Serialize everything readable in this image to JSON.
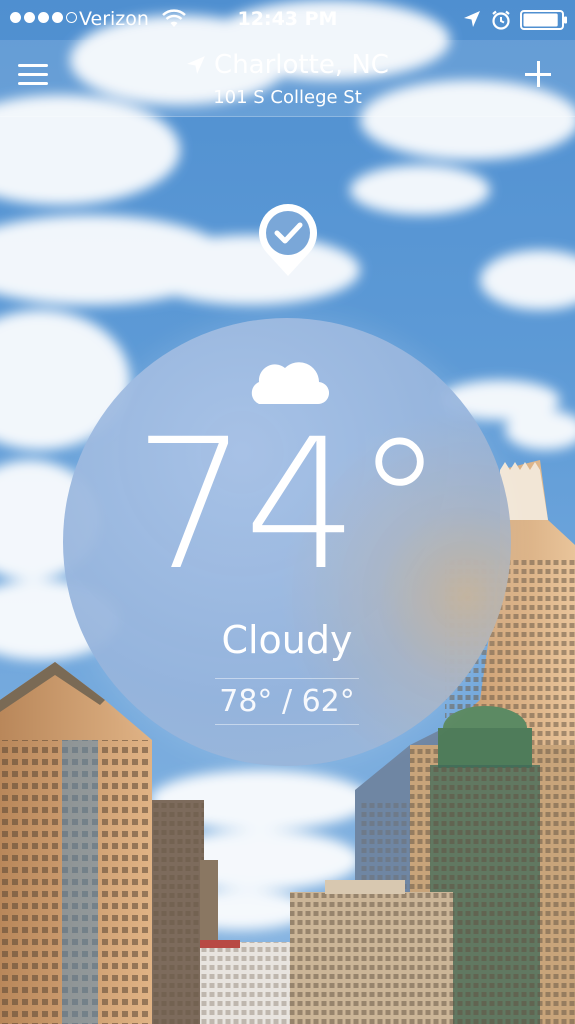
{
  "status_bar": {
    "carrier": "Verizon",
    "time": "12:43 PM",
    "signal_bars_filled": 4,
    "signal_bars_total": 5,
    "battery_level": 0.9
  },
  "nav": {
    "menu_icon": "hamburger-menu-icon",
    "location_icon": "location-arrow-icon",
    "city": "Charlotte, NC",
    "address": "101 S College St",
    "add_icon": "plus-icon"
  },
  "badge_icon": "pin-check-icon",
  "weather": {
    "condition_icon": "cloud-icon",
    "temperature": "74°",
    "condition": "Cloudy",
    "high_low": "78° / 62°"
  },
  "colors": {
    "sky": "#5d9ad6",
    "bubble": "#9dbce4",
    "text": "#ffffff"
  }
}
